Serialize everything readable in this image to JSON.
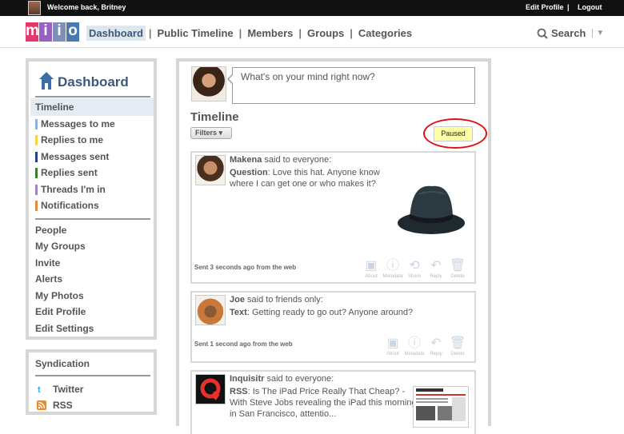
{
  "topbar": {
    "welcome": "Welcome back, Britney",
    "edit_profile": "Edit Profile",
    "separator": "|",
    "logout": "Logout"
  },
  "logo": {
    "letters": [
      "m",
      "i",
      "i",
      "o"
    ],
    "colors": [
      "#e23a6d",
      "#9b5fc0",
      "#7f8fb7",
      "#4a79b0"
    ]
  },
  "nav": {
    "items": [
      "Dashboard",
      "Public Timeline",
      "Members",
      "Groups",
      "Categories"
    ],
    "divider": "|",
    "search_label": "Search"
  },
  "sidebar": {
    "title": "Dashboard",
    "timeline_items": [
      {
        "label": "Timeline",
        "color": ""
      },
      {
        "label": "Messages to me",
        "color": "#8fb0e0"
      },
      {
        "label": "Replies to me",
        "color": "#f1d84a"
      },
      {
        "label": "Messages sent",
        "color": "#2a3f86"
      },
      {
        "label": "Replies sent",
        "color": "#3e7d2e"
      },
      {
        "label": "Threads I'm in",
        "color": "#a084c6"
      },
      {
        "label": "Notifications",
        "color": "#e88a3a"
      }
    ],
    "other_items": [
      "People",
      "My Groups",
      "Invite",
      "Alerts",
      "My Photos",
      "Edit Profile",
      "Edit Settings"
    ]
  },
  "syndication": {
    "title": "Syndication",
    "links": [
      "Twitter",
      "RSS"
    ]
  },
  "composer": {
    "placeholder": "What's on your mind right now?"
  },
  "timeline": {
    "title": "Timeline",
    "filters_label": "Filters",
    "paused_label": "Paused"
  },
  "actions": [
    "About",
    "Metadata",
    "Share",
    "Reply",
    "Delete"
  ],
  "posts": [
    {
      "author": "Makena",
      "audience": "said to everyone:",
      "type": "Question",
      "text_lines": [
        "Love this hat. Anyone know",
        "where I can get one or who makes it?"
      ],
      "sent": "Sent 3 seconds ago from the web"
    },
    {
      "author": "Joe",
      "audience": "said to friends only:",
      "type": "Text",
      "text_lines": [
        "Getting ready to go out? Anyone around?"
      ],
      "sent": "Sent 1 second ago from the web"
    },
    {
      "author": "Inquisitr",
      "audience": "said to everyone:",
      "type": "RSS",
      "text_lines": [
        "Is The iPad Price Really That Cheap? -",
        "With Steve Jobs revealing the iPad this morning",
        "in San Francisco, attentio..."
      ],
      "sent": ""
    }
  ]
}
